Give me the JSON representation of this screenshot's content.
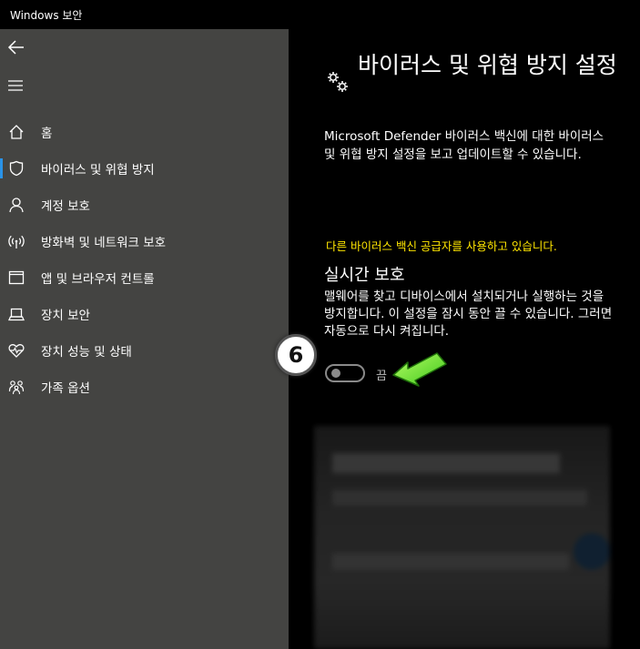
{
  "window": {
    "title": "Windows 보안"
  },
  "sidebar": {
    "back_icon": "back-arrow-icon",
    "menu_icon": "hamburger-icon",
    "items": [
      {
        "label": "홈",
        "icon": "home-icon"
      },
      {
        "label": "바이러스 및 위협 방지",
        "icon": "shield-icon",
        "active": true
      },
      {
        "label": "계정 보호",
        "icon": "person-icon"
      },
      {
        "label": "방화벽 및 네트워크 보호",
        "icon": "wifi-icon"
      },
      {
        "label": "앱 및 브라우저 컨트롤",
        "icon": "browser-window-icon"
      },
      {
        "label": "장치 보안",
        "icon": "laptop-icon"
      },
      {
        "label": "장치 성능 및 상태",
        "icon": "heart-pulse-icon"
      },
      {
        "label": "가족 옵션",
        "icon": "family-icon"
      }
    ]
  },
  "main": {
    "title": "바이러스 및 위협 방지 설정",
    "description": "Microsoft Defender 바이러스 백신에 대한 바이러스 및 위협 방지 설정을 보고 업데이트할 수 있습니다.",
    "warning": "다른 바이러스 백신 공급자를 사용하고 있습니다.",
    "realtime": {
      "title": "실시간 보호",
      "description": "맬웨어를 찾고 디바이스에서 설치되거나 실행하는 것을 방지합니다. 이 설정을 잠시 동안 끌 수 있습니다. 그러면 자동으로 다시 켜집니다.",
      "toggle_state": "끔"
    }
  },
  "annotation": {
    "step_number": "6"
  },
  "colors": {
    "accent": "#2a93e8",
    "warning": "#ffe600",
    "sidebar_bg": "#444442",
    "arrow": "#6ee82a"
  }
}
